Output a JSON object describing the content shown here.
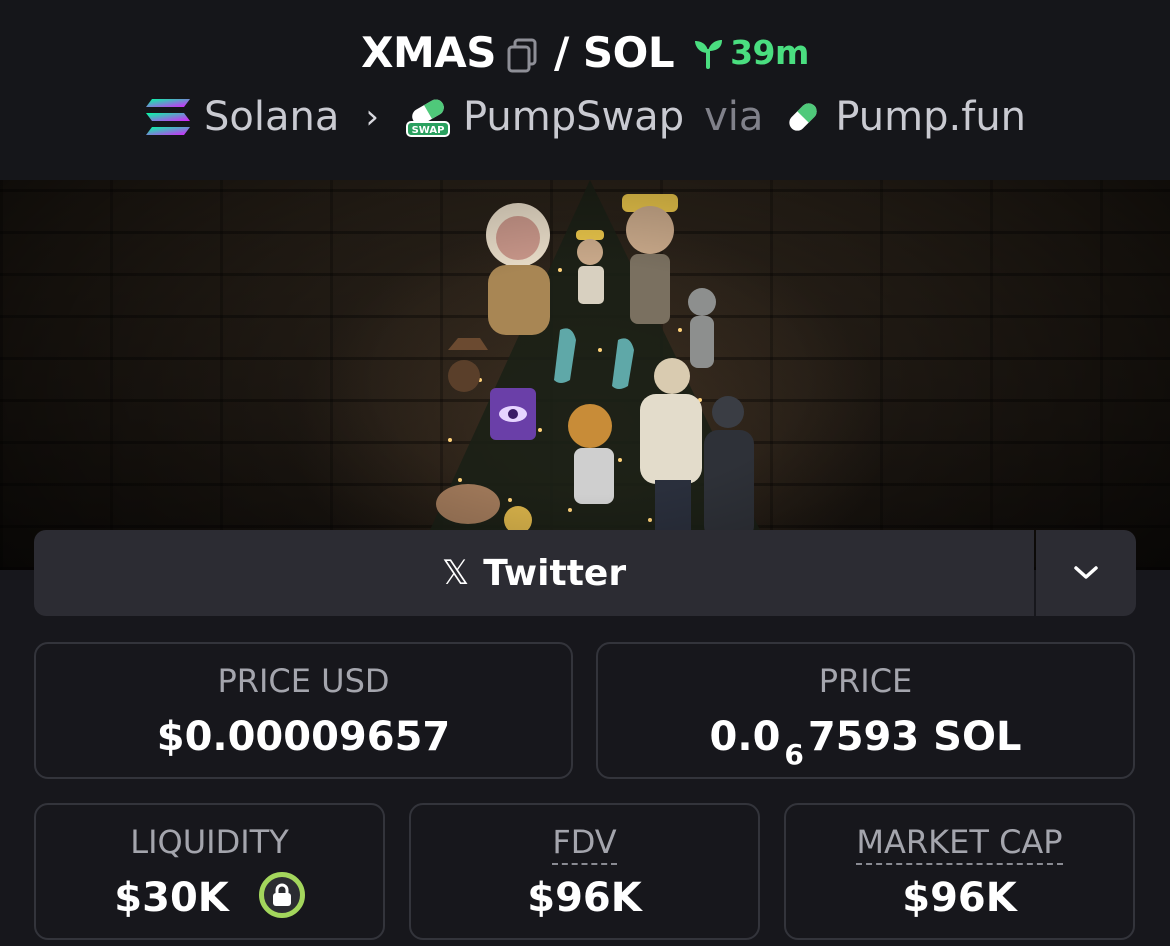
{
  "header": {
    "base_symbol": "XMAS",
    "separator": "/",
    "quote_symbol": "SOL",
    "age": "39m",
    "chain": "Solana",
    "dex": "PumpSwap",
    "via": "via",
    "launchpad": "Pump.fun",
    "dex_icon_text": "SWAP"
  },
  "banner": {
    "description": "XMAS token banner"
  },
  "links": {
    "primary_label": "Twitter"
  },
  "stats": {
    "price_usd": {
      "label": "PRICE USD",
      "value": "$0.00009657"
    },
    "price": {
      "label": "PRICE",
      "value_prefix": "0.0",
      "value_subscript": "6",
      "value_suffix": "7593 SOL"
    },
    "liquidity": {
      "label": "LIQUIDITY",
      "value": "$30K"
    },
    "fdv": {
      "label": "FDV",
      "value": "$96K"
    },
    "market_cap": {
      "label": "MARKET CAP",
      "value": "$96K"
    }
  },
  "colors": {
    "accent_green": "#4ade80",
    "lock_ring": "#a3d65c",
    "card_border": "#33343b"
  },
  "icons": [
    "copy-icon",
    "sprout-icon",
    "solana-icon",
    "pumpswap-icon",
    "pill-icon",
    "x-icon",
    "chevron-down-icon",
    "lock-icon"
  ]
}
